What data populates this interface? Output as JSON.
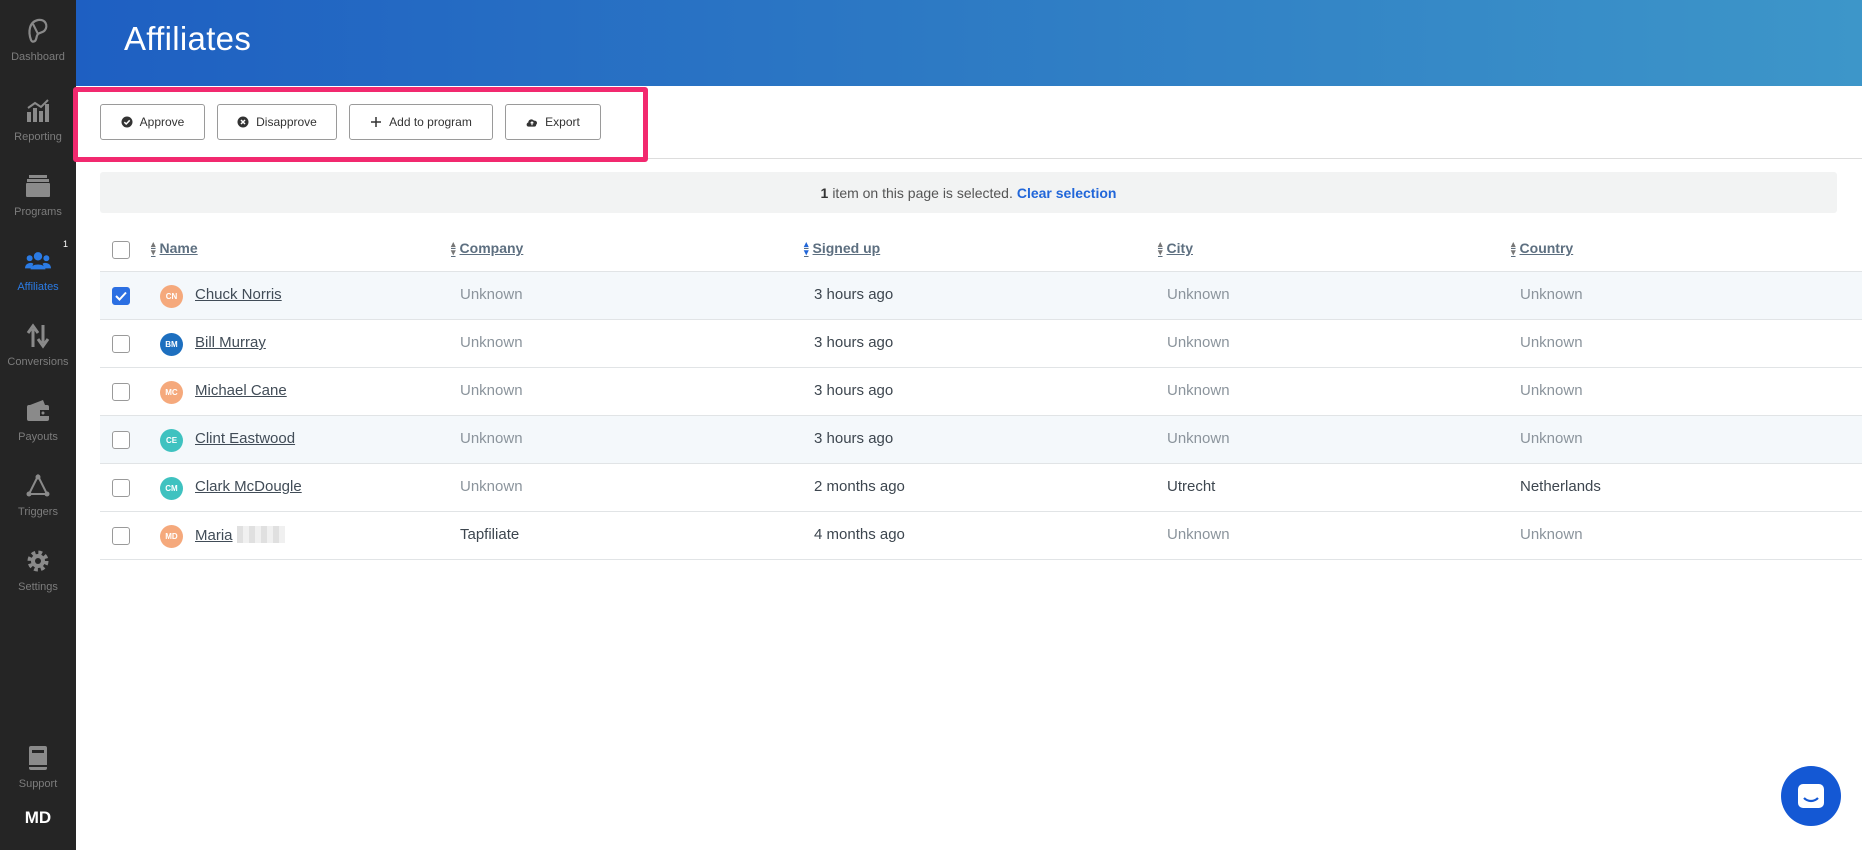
{
  "sidebar": {
    "items": [
      {
        "label": "Dashboard",
        "icon": "dashboard-icon"
      },
      {
        "label": "Reporting",
        "icon": "bar-chart-icon"
      },
      {
        "label": "Programs",
        "icon": "programs-icon"
      },
      {
        "label": "Affiliates",
        "icon": "users-icon",
        "active": true,
        "badge": "1"
      },
      {
        "label": "Conversions",
        "icon": "transfer-arrows-icon"
      },
      {
        "label": "Payouts",
        "icon": "wallet-icon"
      },
      {
        "label": "Triggers",
        "icon": "triggers-icon"
      },
      {
        "label": "Settings",
        "icon": "gear-icon"
      }
    ],
    "support_label": "Support",
    "user_initials": "MD"
  },
  "header": {
    "title": "Affiliates"
  },
  "toolbar": {
    "approve_label": "Approve",
    "disapprove_label": "Disapprove",
    "add_to_program_label": "Add to program",
    "export_label": "Export"
  },
  "selection": {
    "count": "1",
    "text": "item on this page is selected.",
    "clear_label": "Clear selection"
  },
  "table": {
    "columns": [
      "Name",
      "Company",
      "Signed up",
      "City",
      "Country"
    ],
    "rows": [
      {
        "initials": "CN",
        "avatar_color": "#f5a97c",
        "name": "Chuck Norris",
        "company": "Unknown",
        "signed_up": "3 hours ago",
        "city": "Unknown",
        "country": "Unknown",
        "checked": true
      },
      {
        "initials": "BM",
        "avatar_color": "#1d6fbf",
        "name": "Bill Murray",
        "company": "Unknown",
        "signed_up": "3 hours ago",
        "city": "Unknown",
        "country": "Unknown",
        "checked": false
      },
      {
        "initials": "MC",
        "avatar_color": "#f5a97c",
        "name": "Michael Cane",
        "company": "Unknown",
        "signed_up": "3 hours ago",
        "city": "Unknown",
        "country": "Unknown",
        "checked": false
      },
      {
        "initials": "CE",
        "avatar_color": "#3fc2c0",
        "name": "Clint Eastwood",
        "company": "Unknown",
        "signed_up": "3 hours ago",
        "city": "Unknown",
        "country": "Unknown",
        "checked": false
      },
      {
        "initials": "CM",
        "avatar_color": "#3fc2c0",
        "name": "Clark McDougle",
        "company": "Unknown",
        "signed_up": "2 months ago",
        "city": "Utrecht",
        "country": "Netherlands",
        "checked": false
      },
      {
        "initials": "MD",
        "avatar_color": "#f5a97c",
        "name": "Maria",
        "company": "Tapfiliate",
        "signed_up": "4 months ago",
        "city": "Unknown",
        "country": "Unknown",
        "checked": false
      }
    ]
  },
  "colors": {
    "accent": "#2b7be4",
    "highlight": "#f2296f",
    "chat": "#1458d4"
  }
}
